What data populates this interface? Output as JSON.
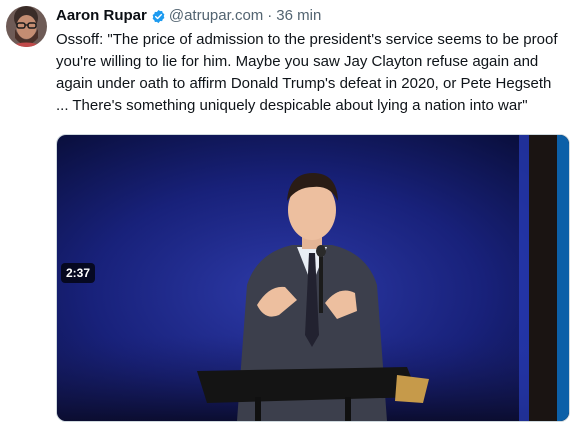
{
  "author": {
    "name": "Aaron Rupar",
    "handle": "@atrupar.com",
    "separator": "·",
    "time": "36 min"
  },
  "post": {
    "text": "Ossoff: \"The price of admission to the president's service seems to be proof you're willing to lie for him. Maybe you saw Jay Clayton refuse again and again under oath to affirm Donald Trump's defeat in 2020, or Pete Hegseth ... There's something uniquely despicable about lying a nation into war\""
  },
  "video": {
    "duration": "2:37"
  },
  "icons": {
    "verified": "verified-check-icon",
    "avatar": "avatar"
  },
  "colors": {
    "verified_blue": "#1d9bf0",
    "secondary_text": "#536471"
  }
}
